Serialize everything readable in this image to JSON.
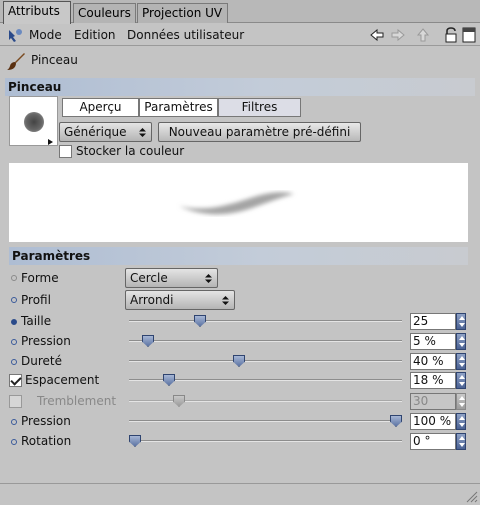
{
  "tabs": [
    {
      "label": "Attributs",
      "active": true
    },
    {
      "label": "Couleurs",
      "active": false
    },
    {
      "label": "Projection UV",
      "active": false
    }
  ],
  "menubar": {
    "mode_label": "Mode",
    "edition_label": "Edition",
    "user_data_label": "Données utilisateur",
    "icons": [
      "mode-icon",
      "back-arrow-icon",
      "forward-arrow-icon",
      "up-arrow-icon",
      "lock-icon",
      "new-window-icon"
    ]
  },
  "object": {
    "name": "Pinceau",
    "icon": "brush-icon"
  },
  "brush_section": {
    "title": "Pinceau",
    "subtabs": [
      {
        "label": "Aperçu",
        "active": false
      },
      {
        "label": "Paramètres",
        "active": false
      },
      {
        "label": "Filtres",
        "active": true
      }
    ],
    "preset_dropdown": "Générique",
    "new_preset_button": "Nouveau paramètre pré-défini",
    "store_color_label": "Stocker la couleur",
    "store_color_checked": false
  },
  "params_section": {
    "title": "Paramètres",
    "forme": {
      "label": "Forme",
      "value": "Cercle"
    },
    "profil": {
      "label": "Profil",
      "value": "Arrondi"
    },
    "rows": [
      {
        "label": "Taille",
        "value": "25",
        "fraction": 0.25,
        "enabled": true,
        "checkbox": false
      },
      {
        "label": "Pression",
        "value": "5 %",
        "fraction": 0.05,
        "enabled": true,
        "checkbox": false
      },
      {
        "label": "Dureté",
        "value": "40 %",
        "fraction": 0.4,
        "enabled": true,
        "checkbox": false
      },
      {
        "label": "Espacement",
        "value": "18 %",
        "fraction": 0.13,
        "enabled": true,
        "checkbox": true,
        "checked": true
      },
      {
        "label": "Tremblement",
        "value": "30",
        "fraction": 0.17,
        "enabled": false,
        "checkbox": true,
        "checked": false
      },
      {
        "label": "Pression",
        "value": "100 %",
        "fraction": 1.0,
        "enabled": true,
        "checkbox": false
      },
      {
        "label": "Rotation",
        "value": "0 °",
        "fraction": 0.0,
        "enabled": true,
        "checkbox": false
      }
    ]
  },
  "colors": {
    "section_header_start": "#aebdd3",
    "slider_thumb": "#6d83b0",
    "accent_dot": "#2a4a8a"
  }
}
